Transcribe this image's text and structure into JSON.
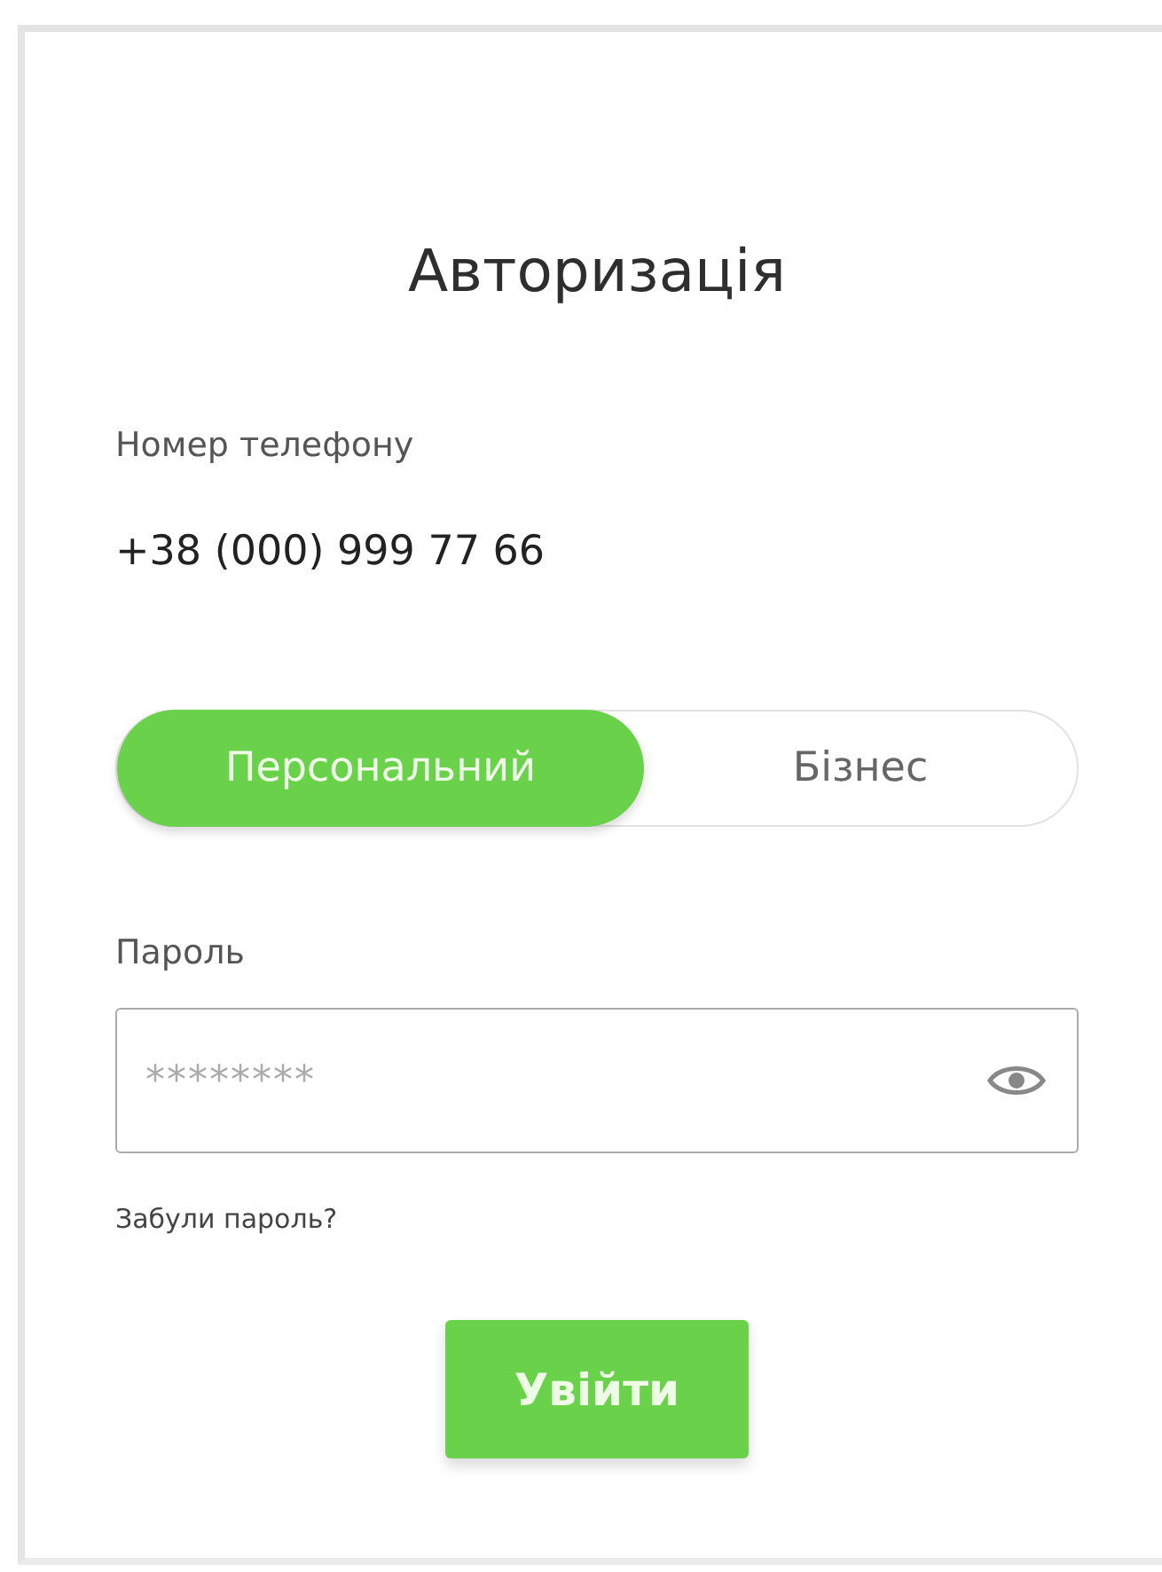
{
  "title": "Авторизація",
  "phone": {
    "label": "Номер телефону",
    "value": "+38 (000) 999 77 66"
  },
  "account_types": [
    {
      "label": "Персональний",
      "selected": true
    },
    {
      "label": "Бізнес",
      "selected": false
    }
  ],
  "password": {
    "label": "Пароль",
    "placeholder": "********"
  },
  "forgot_link": "Забули пароль?",
  "submit_button": "Увійти"
}
